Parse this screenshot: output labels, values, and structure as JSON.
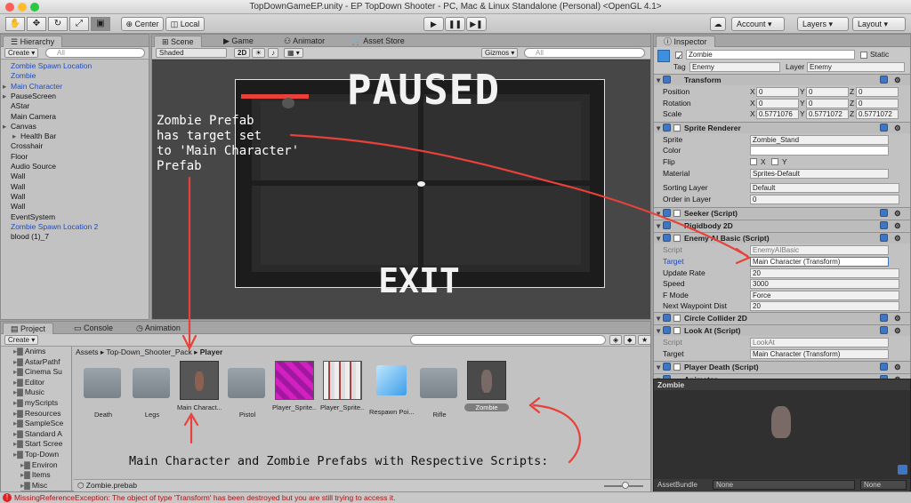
{
  "window": {
    "title": "TopDownGameEP.unity - EP TopDown Shooter - PC, Mac & Linux Standalone (Personal) <OpenGL 4.1>"
  },
  "toolbar": {
    "pivot_center": "Center",
    "pivot_local": "Local",
    "account": "Account",
    "layers": "Layers",
    "layout": "Layout",
    "play_icon": "play-icon",
    "pause_icon": "pause-icon",
    "step_icon": "step-icon"
  },
  "hierarchy": {
    "tab": "Hierarchy",
    "create": "Create",
    "search_placeholder": "All",
    "items": [
      {
        "label": "Zombie Spawn Location",
        "blue": true
      },
      {
        "label": "Zombie",
        "blue": true
      },
      {
        "label": "Main Character",
        "blue": true
      },
      {
        "label": "PauseScreen",
        "blue": false
      },
      {
        "label": "AStar",
        "blue": false
      },
      {
        "label": "Main Camera",
        "blue": false
      },
      {
        "label": "Canvas",
        "blue": false
      },
      {
        "label": "Health Bar",
        "blue": false
      },
      {
        "label": "Crosshair",
        "blue": false
      },
      {
        "label": "Floor",
        "blue": false
      },
      {
        "label": "Audio Source",
        "blue": false
      },
      {
        "label": "Wall",
        "blue": false
      },
      {
        "label": "Wall",
        "blue": false
      },
      {
        "label": "Wall",
        "blue": false
      },
      {
        "label": "Wall",
        "blue": false
      },
      {
        "label": "EventSystem",
        "blue": false
      },
      {
        "label": "Zombie Spawn Location 2",
        "blue": true
      },
      {
        "label": "blood (1)_7",
        "blue": false
      }
    ]
  },
  "scene": {
    "tabs": [
      "Scene",
      "Game",
      "Animator",
      "Asset Store"
    ],
    "shading": "Shaded",
    "mode_2d": "2D",
    "gizmos": "Gizmos",
    "search_placeholder": "All",
    "paused_text": "PAUSED",
    "exit_text": "EXIT"
  },
  "project": {
    "tabs": [
      "Project",
      "Console",
      "Animation"
    ],
    "create": "Create",
    "breadcrumb": [
      "Assets",
      "Top-Down_Shooter_Pack",
      "Player"
    ],
    "tree": [
      {
        "label": "Anims",
        "indent": 1
      },
      {
        "label": "AstarPathf",
        "indent": 1
      },
      {
        "label": "Cinema Su",
        "indent": 1
      },
      {
        "label": "Editor",
        "indent": 1
      },
      {
        "label": "Music",
        "indent": 1
      },
      {
        "label": "myScripts",
        "indent": 1
      },
      {
        "label": "Resources",
        "indent": 1
      },
      {
        "label": "SampleSce",
        "indent": 1
      },
      {
        "label": "Standard A",
        "indent": 1
      },
      {
        "label": "Start Scree",
        "indent": 1
      },
      {
        "label": "Top-Down",
        "indent": 1
      },
      {
        "label": "Environ",
        "indent": 2
      },
      {
        "label": "Items",
        "indent": 2
      },
      {
        "label": "Misc",
        "indent": 2
      },
      {
        "label": "Player",
        "indent": 2
      }
    ],
    "assets": [
      {
        "label": "Death",
        "kind": "folder"
      },
      {
        "label": "Legs",
        "kind": "folder"
      },
      {
        "label": "Main Charact...",
        "kind": "prefab-char"
      },
      {
        "label": "Pistol",
        "kind": "folder"
      },
      {
        "label": "Player_Sprite...",
        "kind": "sprite-pink"
      },
      {
        "label": "Player_Sprite...",
        "kind": "sprite-sheet"
      },
      {
        "label": "Respawn Poi...",
        "kind": "cube"
      },
      {
        "label": "Rifle",
        "kind": "folder"
      },
      {
        "label": "Zombie",
        "kind": "prefab-zombie"
      }
    ],
    "selected_file": "Zombie.prebab"
  },
  "inspector": {
    "tab": "Inspector",
    "object_name": "Zombie",
    "static_label": "Static",
    "tag_label": "Tag",
    "tag_value": "Enemy",
    "layer_label": "Layer",
    "layer_value": "Enemy",
    "transform": {
      "title": "Transform",
      "rows": [
        {
          "label": "Position",
          "x": "0",
          "y": "0",
          "z": "0"
        },
        {
          "label": "Rotation",
          "x": "0",
          "y": "0",
          "z": "0"
        },
        {
          "label": "Scale",
          "x": "0.5771076",
          "y": "0.5771072",
          "z": "0.5771072"
        }
      ]
    },
    "sprite_renderer": {
      "title": "Sprite Renderer",
      "sprite_label": "Sprite",
      "sprite_value": "Zombie_Stand",
      "color_label": "Color",
      "flip_label": "Flip",
      "flip_x": "X",
      "flip_y": "Y",
      "material_label": "Material",
      "material_value": "Sprites-Default",
      "sorting_label": "Sorting Layer",
      "sorting_value": "Default",
      "order_label": "Order in Layer",
      "order_value": "0"
    },
    "seeker": "Seeker (Script)",
    "rigidbody": "Rigidbody 2D",
    "enemy_ai": {
      "title": "Enemy AI Basic (Script)",
      "script_label": "Script",
      "script_value": "EnemyAIBasic",
      "target_label": "Target",
      "target_value": "Main Character (Transform)",
      "update_label": "Update Rate",
      "update_value": "20",
      "speed_label": "Speed",
      "speed_value": "3000",
      "fmode_label": "F Mode",
      "fmode_value": "Force",
      "waypoint_label": "Next Waypoint Dist",
      "waypoint_value": "20"
    },
    "circle_collider": "Circle Collider 2D",
    "look_at": {
      "title": "Look At (Script)",
      "script_label": "Script",
      "script_value": "LookAt",
      "target_label": "Target",
      "target_value": "Main Character (Transform)"
    },
    "player_death": "Player Death (Script)",
    "animator": "Animator",
    "preview_title": "Zombie",
    "assetbundle_label": "AssetBundle",
    "assetbundle_value": "None",
    "assetbundle_variant": "None"
  },
  "annotations": {
    "zombie_note": "Zombie Prefab\nhas target set\nto 'Main Character'\nPrefab",
    "bottom_note": "Main Character and Zombie Prefabs with Respective Scripts:"
  },
  "status": {
    "message": "MissingReferenceException: The object of type 'Transform' has been destroyed but you are still trying to access it."
  },
  "colors": {
    "annotation_red": "#e8413a",
    "hierarchy_blue": "#1f4cc0",
    "selection": "#3d77c4"
  }
}
